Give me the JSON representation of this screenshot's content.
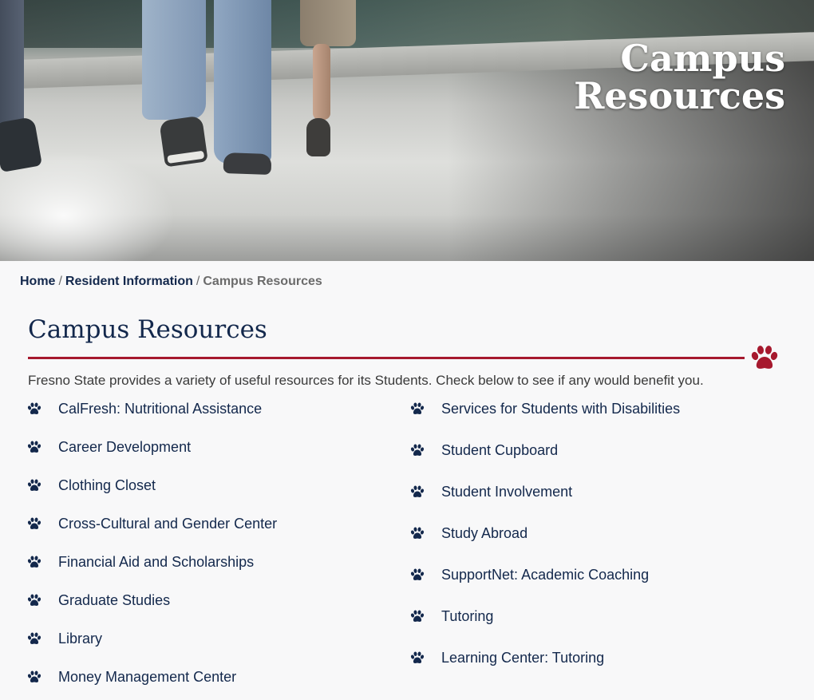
{
  "hero": {
    "title_line1": "Campus",
    "title_line2": "Resources"
  },
  "breadcrumb": {
    "home": "Home",
    "separator": "/",
    "resident_info": "Resident Information",
    "current": "Campus Resources"
  },
  "main": {
    "title": "Campus Resources",
    "intro": "Fresno State provides a variety of useful resources for its Students. Check below to see if any would benefit you.",
    "divider_icon": "paw-icon",
    "left_links": [
      "CalFresh: Nutritional Assistance",
      "Career Development",
      "Clothing Closet",
      "Cross-Cultural and Gender Center",
      "Financial Aid and Scholarships",
      "Graduate Studies",
      "Library",
      "Money Management Center"
    ],
    "right_links": [
      "Services for Students with Disabilities",
      "Student Cupboard",
      "Student Involvement",
      "Study Abroad",
      "SupportNet: Academic Coaching",
      "Tutoring",
      "Learning Center: Tutoring"
    ],
    "list_icon": "paw-icon"
  },
  "colors": {
    "navy": "#13284c",
    "cardinal": "#a6192e",
    "background": "#f8f8f9"
  }
}
